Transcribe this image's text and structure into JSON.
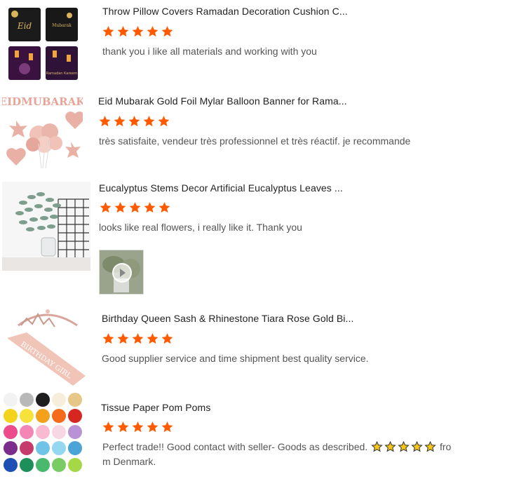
{
  "accent_color": "#ff5a00",
  "reviews": [
    {
      "product_title": "Throw Pillow Covers Ramadan Decoration Cushion C...",
      "rating": 5,
      "comment": "thank you i like all materials and working with you",
      "thumbnail_icon": "pillow-covers-image",
      "pillow_text": [
        "Eid",
        "Mubarak",
        "Ramadan Kareem"
      ]
    },
    {
      "product_title": "Eid Mubarak Gold Foil Mylar Balloon Banner for Rama...",
      "rating": 5,
      "comment": "très satisfaite, vendeur très professionnel et très réactif. je recommande",
      "thumbnail_icon": "balloon-banner-image",
      "banner_text": "EIDMUBARAK"
    },
    {
      "product_title": "Eucalyptus Stems Decor Artificial Eucalyptus Leaves ...",
      "rating": 5,
      "comment": "looks like real flowers, i really like it.  Thank you",
      "thumbnail_icon": "eucalyptus-image",
      "has_video": true
    },
    {
      "product_title": "Birthday Queen Sash & Rhinestone Tiara Rose Gold Bi...",
      "rating": 5,
      "comment": "Good supplier service and time shipment best quality service.",
      "thumbnail_icon": "sash-tiara-image",
      "sash_text": "BIRTHDAY GIRL"
    },
    {
      "product_title": "Tissue Paper Pom Poms",
      "rating": 5,
      "comment_before": "Perfect trade!! Good contact with seller- Goods as described.",
      "comment_after_line1": "fro",
      "comment_after_line2": "m Denmark.",
      "thumbnail_icon": "pom-poms-image"
    }
  ]
}
